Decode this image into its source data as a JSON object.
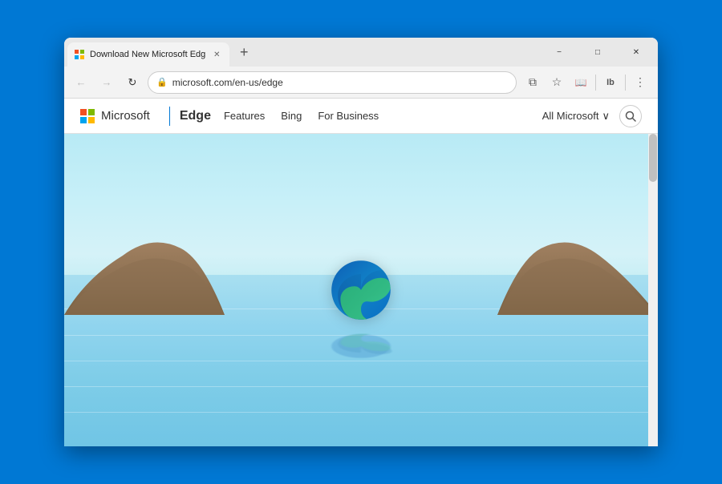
{
  "window": {
    "title": "Download New Microsoft Edge",
    "tab_title": "Download New Microsoft Edg",
    "url": "microsoft.com/en-us/edge",
    "controls": {
      "minimize": "−",
      "maximize": "□",
      "close": "✕"
    }
  },
  "toolbar": {
    "back": "←",
    "forward": "→",
    "refresh": "↻",
    "lock_icon": "🔒",
    "url": "microsoft.com/en-us/edge",
    "copy_icon": "⧉",
    "favorite_icon": "☆",
    "reader_icon": "📖",
    "immersive_reader": "Ib",
    "menu_icon": "⋮",
    "new_tab": "+"
  },
  "site_nav": {
    "brand": "Edge",
    "logo_text": "Microsoft",
    "links": [
      "Features",
      "Bing",
      "For Business"
    ],
    "all_microsoft": "All Microsoft",
    "dropdown_icon": "∨",
    "search_icon": "🔍"
  },
  "hero": {
    "alt_text": "Microsoft Edge hero landscape with Edge logo"
  }
}
